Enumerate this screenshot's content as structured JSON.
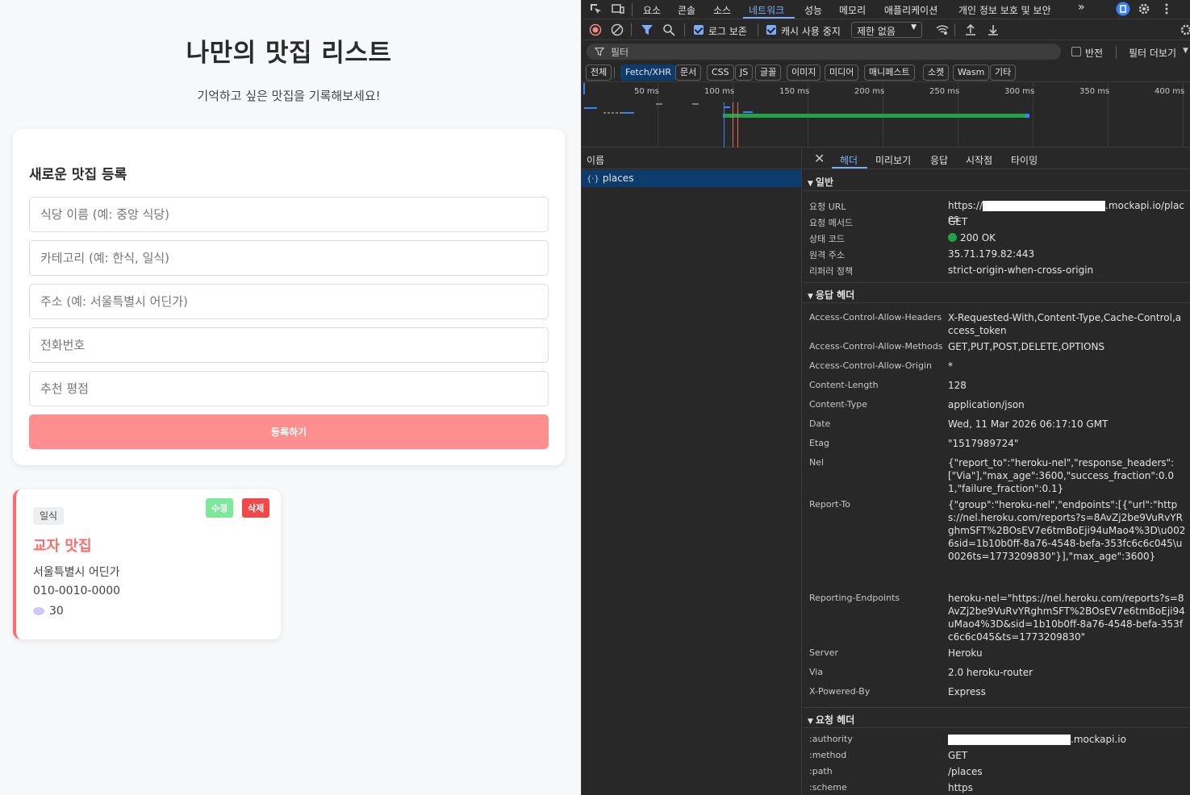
{
  "app": {
    "title": "나만의 맛집 리스트",
    "subtitle": "기억하고 싶은 맛집을 기록해보세요!",
    "form": {
      "heading": "새로운 맛집 등록",
      "name_placeholder": "식당 이름 (예: 중앙 식당)",
      "category_placeholder": "카테고리 (예: 한식, 일식)",
      "address_placeholder": "주소 (예: 서울특별시 어딘가)",
      "phone_placeholder": "전화번호",
      "rating_placeholder": "추천 평점",
      "submit_label": "등록하기"
    },
    "places": [
      {
        "category": "일식",
        "name": "교자 맛집",
        "address": "서울특별시 어딘가",
        "phone": "010-0010-0000",
        "rating": "30",
        "edit_label": "수정",
        "delete_label": "삭제"
      }
    ]
  },
  "devtools": {
    "tabs": [
      "요소",
      "콘솔",
      "소스",
      "네트워크",
      "성능",
      "메모리",
      "애플리케이션",
      "개인 정보 보호 및 보안"
    ],
    "toolbar": {
      "preserve_log": "로그 보존",
      "disable_cache": "캐시 사용 중지",
      "throttle": "제한 없음"
    },
    "filter": {
      "placeholder": "필터",
      "invert": "반전",
      "more_filters": "필터 더보기"
    },
    "types": [
      "전체",
      "Fetch/XHR",
      "문서",
      "CSS",
      "JS",
      "글꼴",
      "이미지",
      "미디어",
      "매니페스트",
      "소켓",
      "Wasm",
      "기타"
    ],
    "active_type": "Fetch/XHR",
    "timeline_ticks": [
      "50 ms",
      "100 ms",
      "150 ms",
      "200 ms",
      "250 ms",
      "300 ms",
      "350 ms",
      "400 ms"
    ],
    "list": {
      "header": "이름",
      "requests": [
        "places"
      ]
    },
    "detail_tabs": [
      "헤더",
      "미리보기",
      "응답",
      "시작점",
      "타이밍"
    ],
    "general": {
      "title": "일반",
      "rows": [
        {
          "name": "요청 URL",
          "value_prefix": "https://",
          "value_suffix": ".mockapi.io/places"
        },
        {
          "name": "요청 메서드",
          "value": "GET"
        },
        {
          "name": "상태 코드",
          "value": "200 OK"
        },
        {
          "name": "원격 주소",
          "value": "35.71.179.82:443"
        },
        {
          "name": "리퍼러 정책",
          "value": "strict-origin-when-cross-origin"
        }
      ]
    },
    "response_headers": {
      "title": "응답 헤더",
      "rows": [
        {
          "name": "Access-Control-Allow-Headers",
          "value": "X-Requested-With,Content-Type,Cache-Control,access_token"
        },
        {
          "name": "Access-Control-Allow-Methods",
          "value": "GET,PUT,POST,DELETE,OPTIONS"
        },
        {
          "name": "Access-Control-Allow-Origin",
          "value": "*"
        },
        {
          "name": "Content-Length",
          "value": "128"
        },
        {
          "name": "Content-Type",
          "value": "application/json"
        },
        {
          "name": "Date",
          "value": "Wed, 11 Mar 2026 06:17:10 GMT"
        },
        {
          "name": "Etag",
          "value": "\"1517989724\""
        },
        {
          "name": "Nel",
          "value": "{\"report_to\":\"heroku-nel\",\"response_headers\":[\"Via\"],\"max_age\":3600,\"success_fraction\":0.01,\"failure_fraction\":0.1}"
        },
        {
          "name": "Report-To",
          "value": "{\"group\":\"heroku-nel\",\"endpoints\":[{\"url\":\"https://nel.heroku.com/reports?s=8AvZj2be9VuRvYRghmSFT%2BOsEV7e6tmBoEji94uMao4%3D\\u0026sid=1b10b0ff-8a76-4548-befa-353fc6c6c045\\u0026ts=1773209830\"}],\"max_age\":3600}"
        },
        {
          "name": "Reporting-Endpoints",
          "value": "heroku-nel=\"https://nel.heroku.com/reports?s=8AvZj2be9VuRvYRghmSFT%2BOsEV7e6tmBoEji94uMao4%3D&sid=1b10b0ff-8a76-4548-befa-353fc6c6c045&ts=1773209830\""
        },
        {
          "name": "Server",
          "value": "Heroku"
        },
        {
          "name": "Via",
          "value": "2.0 heroku-router"
        },
        {
          "name": "X-Powered-By",
          "value": "Express"
        }
      ]
    },
    "request_headers": {
      "title": "요청 헤더",
      "rows": [
        {
          "name": ":authority",
          "value_suffix": ".mockapi.io"
        },
        {
          "name": ":method",
          "value": "GET"
        },
        {
          "name": ":path",
          "value": "/places"
        },
        {
          "name": ":scheme",
          "value": "https"
        }
      ]
    },
    "colors": {
      "accent": "#7cacf8",
      "status_ok": "#1ea446",
      "waterfall": "#1ea446"
    }
  }
}
